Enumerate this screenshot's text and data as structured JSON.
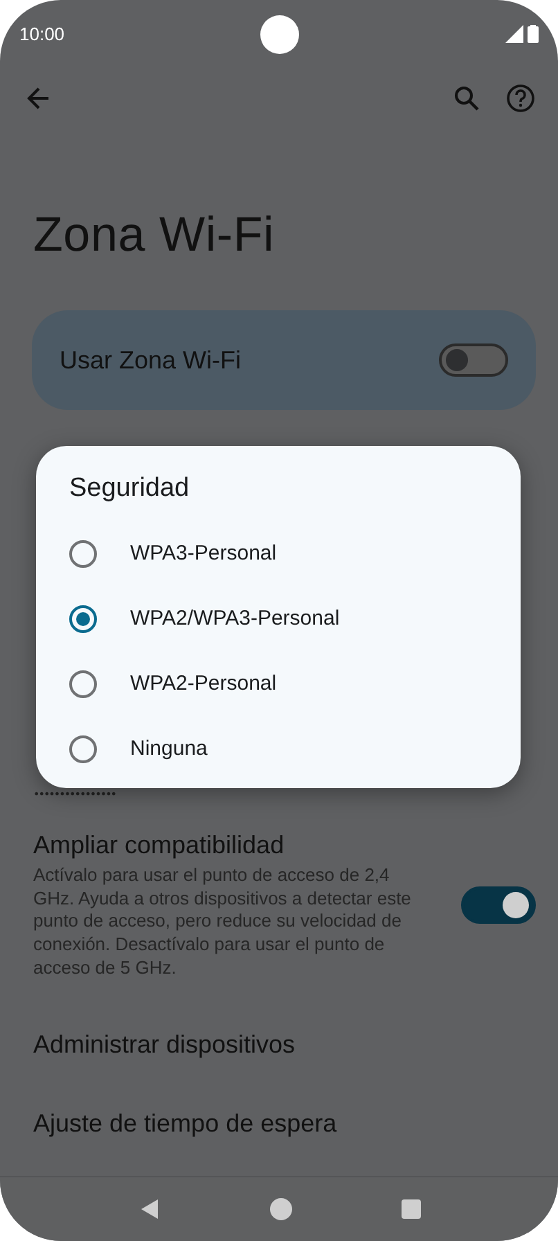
{
  "status_bar": {
    "time": "10:00"
  },
  "title": "Zona Wi-Fi",
  "main_switch": {
    "label": "Usar Zona Wi-Fi",
    "on": false
  },
  "password": {
    "value": "••••••••••••••••"
  },
  "settings": [
    {
      "kind": "switch",
      "title": "Ampliar compatibilidad",
      "summary": "Actívalo para usar el punto de acceso de 2,4 GHz. Ayuda a otros dispositivos a detectar este punto de acceso, pero reduce su velocidad de conexión. Desactívalo para usar el punto de acceso de 5 GHz.",
      "on": true
    },
    {
      "kind": "plain",
      "title": "Administrar dispositivos"
    },
    {
      "kind": "plain",
      "title": "Ajuste de tiempo de espera"
    }
  ],
  "dialog": {
    "title": "Seguridad",
    "options": [
      {
        "label": "WPA3-Personal",
        "selected": false
      },
      {
        "label": "WPA2/WPA3-Personal",
        "selected": true
      },
      {
        "label": "WPA2-Personal",
        "selected": false
      },
      {
        "label": "Ninguna",
        "selected": false
      }
    ]
  }
}
